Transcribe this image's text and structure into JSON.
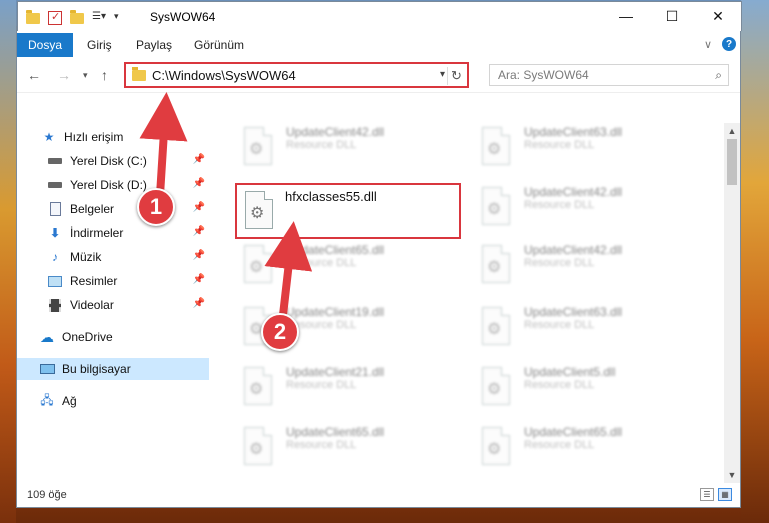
{
  "title_bar": {
    "title": "SysWOW64",
    "minimize": "—",
    "maximize": "☐",
    "close": "✕"
  },
  "ribbon": {
    "tabs": [
      "Dosya",
      "Giriş",
      "Paylaş",
      "Görünüm"
    ],
    "help": "?",
    "expand": "∨"
  },
  "nav": {
    "address": "C:\\Windows\\SysWOW64",
    "search_placeholder": "Ara: SysWOW64"
  },
  "sidebar": {
    "quick_access": "Hızlı erişim",
    "items": [
      {
        "label": "Yerel Disk (C:)",
        "icon": "drive-icon"
      },
      {
        "label": "Yerel Disk (D:)",
        "icon": "drive-icon"
      },
      {
        "label": "Belgeler",
        "icon": "documents-icon"
      },
      {
        "label": "İndirmeler",
        "icon": "download-icon"
      },
      {
        "label": "Müzik",
        "icon": "music-icon"
      },
      {
        "label": "Resimler",
        "icon": "pictures-icon"
      },
      {
        "label": "Videolar",
        "icon": "video-icon"
      }
    ],
    "onedrive": "OneDrive",
    "this_pc": "Bu bilgisayar",
    "network": "Ağ"
  },
  "files": {
    "highlighted": {
      "name": "hfxclasses55.dll"
    },
    "left_column": [
      {
        "name": "UpdateClient42.dll",
        "type": "Resource DLL"
      },
      {
        "name": "UpdateClient65.dll",
        "type": "Resource DLL"
      },
      {
        "name": "UpdateClient19.dll",
        "type": "Resource DLL"
      },
      {
        "name": "UpdateClient21.dll",
        "type": "Resource DLL"
      },
      {
        "name": "UpdateClient65.dll",
        "type": "Resource DLL"
      }
    ],
    "right_column": [
      {
        "name": "UpdateClient63.dll",
        "type": "Resource DLL"
      },
      {
        "name": "UpdateClient42.dll",
        "type": "Resource DLL"
      },
      {
        "name": "UpdateClient42.dll",
        "type": "Resource DLL"
      },
      {
        "name": "UpdateClient63.dll",
        "type": "Resource DLL"
      },
      {
        "name": "UpdateClient5.dll",
        "type": "Resource DLL"
      },
      {
        "name": "UpdateClient65.dll",
        "type": "Resource DLL"
      }
    ]
  },
  "status": {
    "count": "109 öğe"
  },
  "markers": [
    "1",
    "2"
  ],
  "colors": {
    "accent": "#1979ca",
    "highlight_border": "#d9363e",
    "selected_bg": "#cce8ff"
  }
}
